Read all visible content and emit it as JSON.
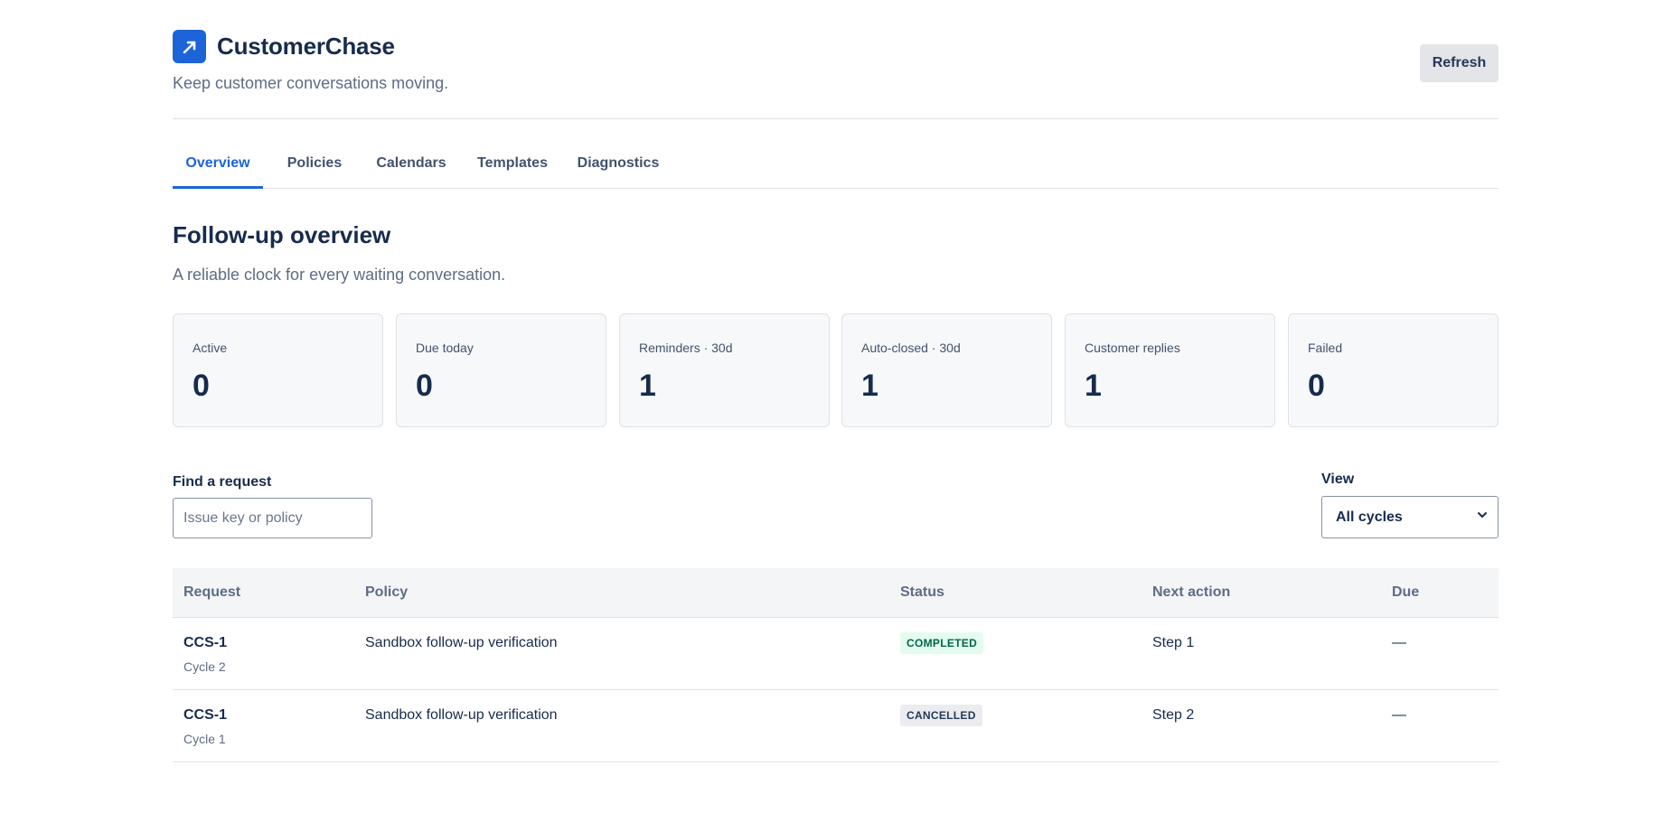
{
  "app": {
    "name": "CustomerChase",
    "tagline": "Keep customer conversations moving.",
    "refresh_label": "Refresh",
    "logo_icon": "arrow-up-right-icon",
    "brand_color": "#1d64d8"
  },
  "tabs": [
    {
      "label": "Overview",
      "active": true
    },
    {
      "label": "Policies",
      "active": false
    },
    {
      "label": "Calendars",
      "active": false
    },
    {
      "label": "Templates",
      "active": false
    },
    {
      "label": "Diagnostics",
      "active": false
    }
  ],
  "overview": {
    "title": "Follow-up overview",
    "subtitle": "A reliable clock for every waiting conversation."
  },
  "stats": [
    {
      "label": "Active",
      "value": "0"
    },
    {
      "label": "Due today",
      "value": "0"
    },
    {
      "label": "Reminders · 30d",
      "value": "1"
    },
    {
      "label": "Auto-closed · 30d",
      "value": "1"
    },
    {
      "label": "Customer replies",
      "value": "1"
    },
    {
      "label": "Failed",
      "value": "0"
    }
  ],
  "filters": {
    "find_label": "Find a request",
    "find_placeholder": "Issue key or policy",
    "find_value": "",
    "view_label": "View",
    "view_selected": "All cycles"
  },
  "table": {
    "columns": [
      "Request",
      "Policy",
      "Status",
      "Next action",
      "Due"
    ],
    "rows": [
      {
        "key": "CCS-1",
        "cycle": "Cycle 2",
        "policy": "Sandbox follow-up verification",
        "status": "COMPLETED",
        "status_color": "#006644",
        "next_action": "Step 1",
        "due": "—"
      },
      {
        "key": "CCS-1",
        "cycle": "Cycle 1",
        "policy": "Sandbox follow-up verification",
        "status": "CANCELLED",
        "status_color": "#253858",
        "next_action": "Step 2",
        "due": "—"
      }
    ]
  }
}
